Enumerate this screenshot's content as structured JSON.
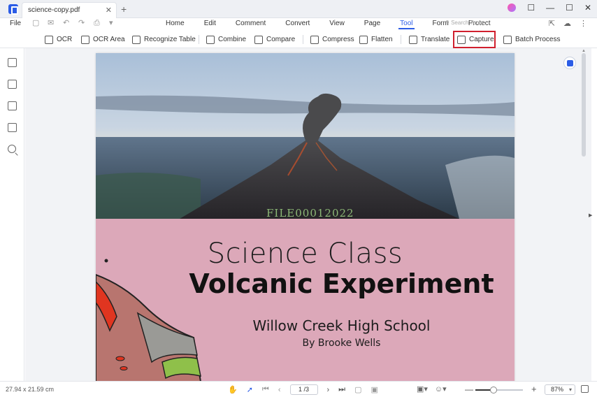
{
  "titlebar": {
    "tab_title": "science-copy.pdf",
    "tab_close": "✕",
    "tab_add": "+"
  },
  "menu": {
    "file_label": "File",
    "tabs": [
      "Home",
      "Edit",
      "Comment",
      "Convert",
      "View",
      "Page",
      "Tool",
      "Form",
      "Protect"
    ],
    "active_tab": "Tool",
    "search_placeholder": "Search Tools"
  },
  "toolbar": {
    "ocr": "OCR",
    "ocr_area": "OCR Area",
    "recognize_table": "Recognize Table",
    "combine": "Combine",
    "compare": "Compare",
    "compress": "Compress",
    "flatten": "Flatten",
    "translate": "Translate",
    "capture": "Capture",
    "batch_process": "Batch Process"
  },
  "document": {
    "watermark": "FILE00012022",
    "title_light": "Science Class",
    "title_bold": "Volcanic Experiment",
    "school": "Willow Creek High School",
    "author": "By Brooke Wells"
  },
  "statusbar": {
    "dimensions": "27.94 x 21.59 cm",
    "page_indicator": "1 /3",
    "zoom_value": "87%",
    "zoom_level": 0.38
  },
  "colors": {
    "accent": "#2b5ce6",
    "capture_highlight": "#d0202e",
    "cover_pink": "#dca8b9"
  }
}
